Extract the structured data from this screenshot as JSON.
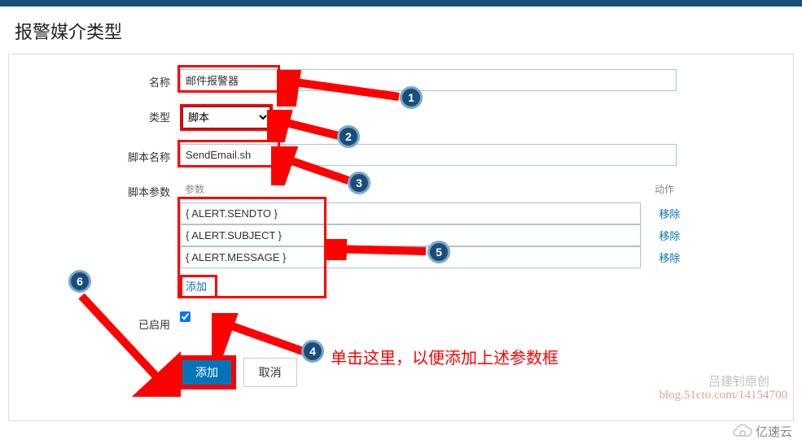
{
  "page_title": "报警媒介类型",
  "form": {
    "name_label": "名称",
    "name_value": "邮件报警器",
    "type_label": "类型",
    "type_value": "脚本",
    "script_name_label": "脚本名称",
    "script_name_value": "SendEmail.sh",
    "script_params_label": "脚本参数",
    "params_header_param": "参数",
    "params_header_action": "动作",
    "params": [
      {
        "value": "{ ALERT.SENDTO }",
        "remove": "移除"
      },
      {
        "value": "{ ALERT.SUBJECT }",
        "remove": "移除"
      },
      {
        "value": "{ ALERT.MESSAGE }",
        "remove": "移除"
      }
    ],
    "add_param": "添加",
    "enabled_label": "已启用",
    "submit": "添加",
    "cancel": "取消"
  },
  "annotations": {
    "b1": "1",
    "b2": "2",
    "b3": "3",
    "b4": "4",
    "b5": "5",
    "b6": "6",
    "hint": "单击这里，以便添加上述参数框",
    "wm1": "吕建钊原创",
    "wm2": "blog.51cto.com/14154700",
    "footer": "亿速云"
  }
}
